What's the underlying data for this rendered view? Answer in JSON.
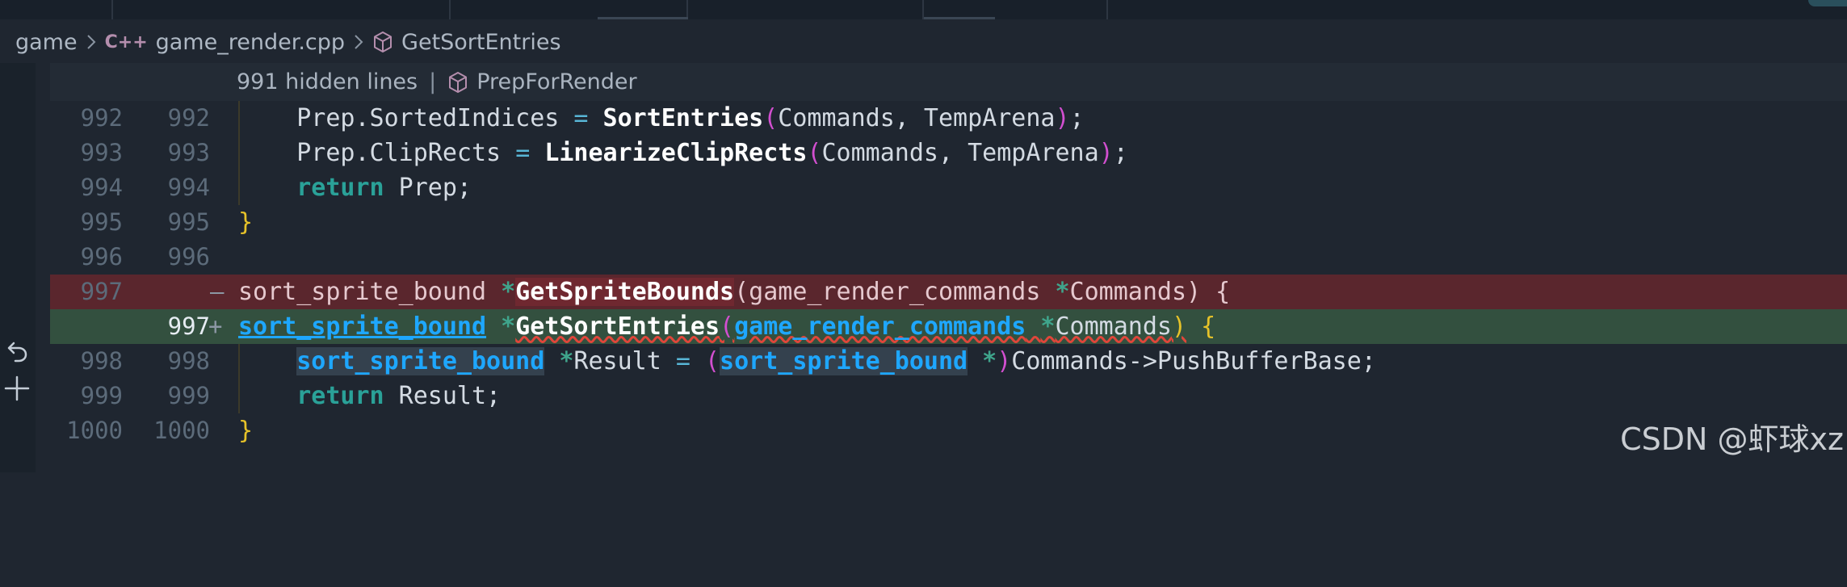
{
  "breadcrumb": {
    "folder": "game",
    "file_lang_badge": "C++",
    "file": "game_render.cpp",
    "symbol": "GetSortEntries"
  },
  "fold": {
    "hidden": "991 hidden lines",
    "separator": "|",
    "symbol": "PrepForRender"
  },
  "lines": [
    {
      "old": "992",
      "new": "992",
      "marker": ""
    },
    {
      "old": "993",
      "new": "993",
      "marker": ""
    },
    {
      "old": "994",
      "new": "994",
      "marker": ""
    },
    {
      "old": "995",
      "new": "995",
      "marker": ""
    },
    {
      "old": "996",
      "new": "996",
      "marker": ""
    },
    {
      "old": "997",
      "new": "",
      "marker": "—"
    },
    {
      "old": "",
      "new": "997",
      "marker": "+"
    },
    {
      "old": "998",
      "new": "998",
      "marker": ""
    },
    {
      "old": "999",
      "new": "999",
      "marker": ""
    },
    {
      "old": "1000",
      "new": "1000",
      "marker": ""
    }
  ],
  "code": {
    "l992": {
      "indent": "    ",
      "pre": "Prep.SortedIndices ",
      "eq": "=",
      "sp": " ",
      "fn": "SortEntries",
      "open": "(",
      "args": "Commands, TempArena",
      "close": ")",
      "semi": ";"
    },
    "l993": {
      "indent": "    ",
      "pre": "Prep.ClipRects ",
      "eq": "=",
      "sp": " ",
      "fn": "LinearizeClipRects",
      "open": "(",
      "args": "Commands, TempArena",
      "close": ")",
      "semi": ";"
    },
    "l994": {
      "indent": "    ",
      "kw": "return",
      "rest": " Prep;"
    },
    "l995": {
      "brace": "}"
    },
    "l997del": {
      "type": "sort_sprite_bound ",
      "star": "*",
      "fn": "GetSpriteBounds",
      "rest": "(game_render_commands ",
      "star2": "*",
      "rest2": "Commands) {"
    },
    "l997ins": {
      "type": "sort_sprite_bound",
      "sp": " ",
      "star": "*",
      "fn": "GetSortEntries",
      "open": "(",
      "ptype": "game_render_commands",
      "sp2": " ",
      "star2": "*",
      "param": "Commands",
      "close": ")",
      "sp3": " ",
      "brace": "{"
    },
    "l998": {
      "indent": "    ",
      "type": "sort_sprite_bound",
      "sp": " ",
      "star": "*",
      "var": "Result ",
      "eq": "=",
      "sp2": " ",
      "open": "(",
      "type2": "sort_sprite_bound",
      "sp3": " ",
      "star2": "*",
      "close": ")",
      "rest": "Commands->PushBufferBase;"
    },
    "l999": {
      "indent": "    ",
      "kw": "return",
      "rest": " Result;"
    },
    "l1000": {
      "brace": "}"
    }
  },
  "watermark": "CSDN @虾球xz",
  "colors": {
    "background": "#1f2630",
    "deleted_line": "#5a262d",
    "inserted_line": "#33503f",
    "keyword": "#2aa198",
    "type": "#1ea7ff",
    "paren": "#d24fd0",
    "brace": "#e6c229"
  },
  "icons": {
    "fold": "snowflake-icon",
    "symbol": "cube-icon",
    "revert": "undo-icon",
    "stage": "plus-icon",
    "separator": "chevron-right-icon"
  }
}
